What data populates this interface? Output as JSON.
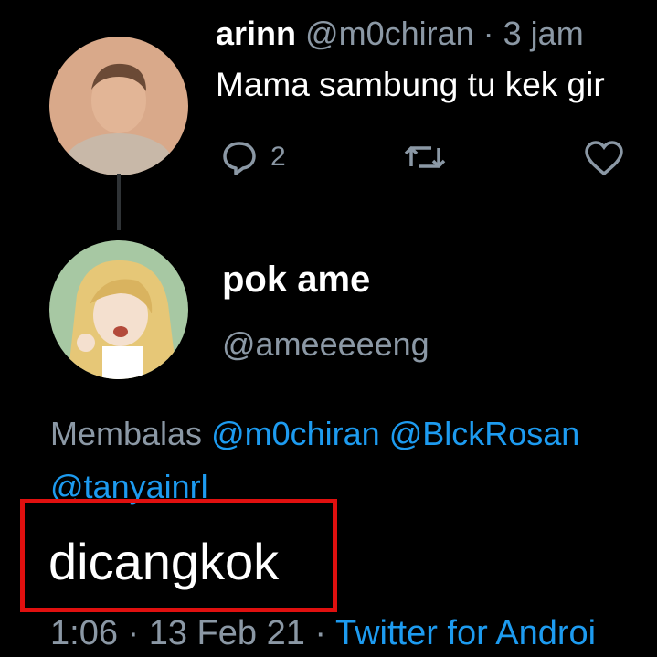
{
  "tweet1": {
    "display_name": "arinn",
    "handle": "@m0chiran",
    "time": "· 3 jam",
    "text": "Mama sambung tu kek gir",
    "reply_count": "2",
    "icons": [
      "reply-icon",
      "retweet-icon",
      "like-icon"
    ]
  },
  "tweet2": {
    "display_name": "pok ame",
    "handle": "@ameeeeeng",
    "replying_label": "Membalas",
    "mention1": "@m0chiran",
    "mention2": "@BlckRosan",
    "mention3": "@tanyainrl",
    "text": "dicangkok",
    "timestamp": "1:06 · 13 Feb 21 ·",
    "source": "Twitter for Androi"
  },
  "colors": {
    "background": "#000000",
    "link": "#1d9bf0",
    "muted": "#8b98a5",
    "highlight_box": "#e0100f"
  }
}
